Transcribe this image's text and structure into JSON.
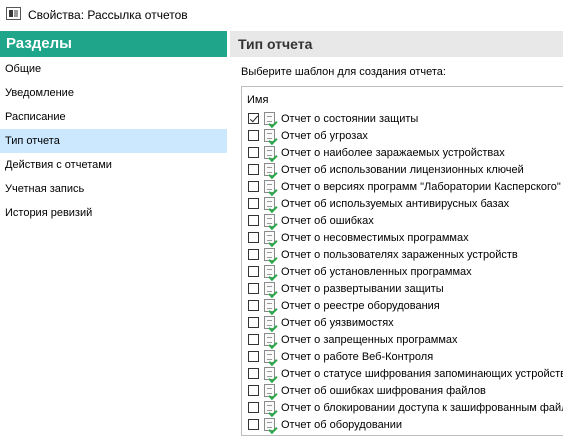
{
  "window": {
    "title": "Свойства: Рассылка отчетов"
  },
  "sidebar": {
    "header": "Разделы",
    "items": [
      {
        "label": "Общие",
        "selected": false
      },
      {
        "label": "Уведомление",
        "selected": false
      },
      {
        "label": "Расписание",
        "selected": false
      },
      {
        "label": "Тип отчета",
        "selected": true
      },
      {
        "label": "Действия с отчетами",
        "selected": false
      },
      {
        "label": "Учетная запись",
        "selected": false
      },
      {
        "label": "История ревизий",
        "selected": false
      }
    ]
  },
  "main": {
    "header": "Тип отчета",
    "template_label": "Выберите шаблон для создания отчета:",
    "list_header": "Имя",
    "reports": [
      {
        "label": "Отчет о состоянии защиты",
        "checked": true
      },
      {
        "label": "Отчет об угрозах",
        "checked": false
      },
      {
        "label": "Отчет о наиболее заражаемых устройствах",
        "checked": false
      },
      {
        "label": "Отчет об использовании лицензионных ключей",
        "checked": false
      },
      {
        "label": "Отчет о версиях программ \"Лаборатории Касперского\"",
        "checked": false
      },
      {
        "label": "Отчет об используемых антивирусных базах",
        "checked": false
      },
      {
        "label": "Отчет об ошибках",
        "checked": false
      },
      {
        "label": "Отчет о несовместимых программах",
        "checked": false
      },
      {
        "label": "Отчет о пользователях зараженных устройств",
        "checked": false
      },
      {
        "label": "Отчет об установленных программах",
        "checked": false
      },
      {
        "label": "Отчет о развертывании защиты",
        "checked": false
      },
      {
        "label": "Отчет о реестре оборудования",
        "checked": false
      },
      {
        "label": "Отчет об уязвимостях",
        "checked": false
      },
      {
        "label": "Отчет о запрещенных программах",
        "checked": false
      },
      {
        "label": "Отчет о работе Веб-Контроля",
        "checked": false
      },
      {
        "label": "Отчет о статусе шифрования запоминающих устройств",
        "checked": false
      },
      {
        "label": "Отчет об ошибках шифрования файлов",
        "checked": false
      },
      {
        "label": "Отчет о блокировании доступа к зашифрованным файлам",
        "checked": false
      },
      {
        "label": "Отчет об оборудовании",
        "checked": false
      }
    ]
  },
  "colors": {
    "accent": "#1ea58a",
    "selection": "#cce8ff",
    "section_header_bg": "#e8e8e8"
  },
  "icons": {
    "app": "window-icon",
    "report": "report-document-icon"
  }
}
